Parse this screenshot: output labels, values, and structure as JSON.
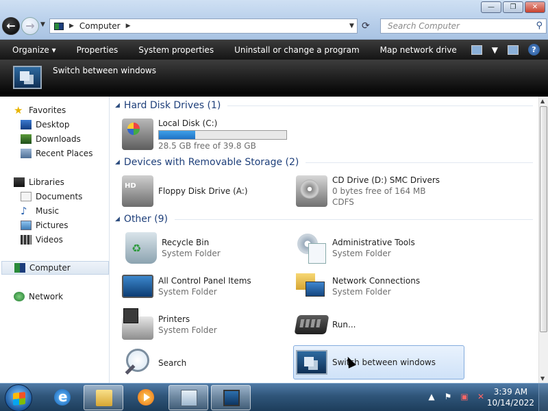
{
  "window": {
    "buttons": {
      "minimize": "—",
      "maximize": "❐",
      "close": "✕"
    }
  },
  "address": {
    "path": "Computer",
    "search_placeholder": "Search Computer"
  },
  "commands": [
    "Organize ▾",
    "Properties",
    "System properties",
    "Uninstall or change a program",
    "Map network drive"
  ],
  "details": {
    "title": "Switch between windows"
  },
  "nav": {
    "favorites": "Favorites",
    "desktop": "Desktop",
    "downloads": "Downloads",
    "recent": "Recent Places",
    "libraries": "Libraries",
    "documents": "Documents",
    "music": "Music",
    "pictures": "Pictures",
    "videos": "Videos",
    "computer": "Computer",
    "network": "Network"
  },
  "groups": {
    "hdd": "Hard Disk Drives (1)",
    "removable": "Devices with Removable Storage (2)",
    "other": "Other (9)"
  },
  "items": {
    "local_disk": {
      "name": "Local Disk (C:)",
      "free": "28.5 GB free of 39.8 GB",
      "used_fraction": 0.284
    },
    "floppy": {
      "name": "Floppy Disk Drive (A:)"
    },
    "cd": {
      "name": "CD Drive (D:) SMC Drivers",
      "free": "0 bytes free of 164 MB",
      "fs": "CDFS"
    },
    "recycle": {
      "name": "Recycle Bin",
      "type": "System Folder"
    },
    "admin": {
      "name": "Administrative Tools",
      "type": "System Folder"
    },
    "cpl": {
      "name": "All Control Panel Items",
      "type": "System Folder"
    },
    "netconn": {
      "name": "Network Connections",
      "type": "System Folder"
    },
    "printers": {
      "name": "Printers",
      "type": "System Folder"
    },
    "run": {
      "name": "Run..."
    },
    "search": {
      "name": "Search"
    },
    "switch": {
      "name": "Switch between windows"
    }
  },
  "taskbar": {
    "time": "3:39 AM",
    "date": "10/14/2022"
  }
}
